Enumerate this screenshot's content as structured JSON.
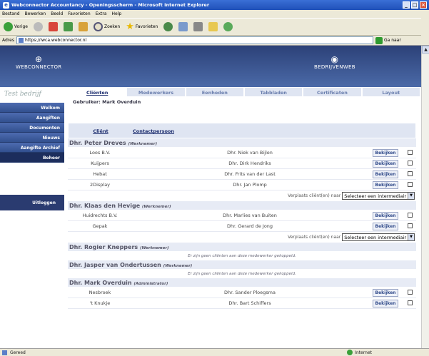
{
  "window": {
    "title": "Webconnector Accountancy - Openingsscherm - Microsoft Internet Explorer"
  },
  "menu": [
    "Bestand",
    "Bewerken",
    "Beeld",
    "Favorieten",
    "Extra",
    "Help"
  ],
  "toolbar": {
    "back": "Vorige",
    "search": "Zoeken",
    "favorites": "Favorieten"
  },
  "address": {
    "label": "Adres",
    "url": "https://iwca.webconnector.nl",
    "go": "Ga naar"
  },
  "header": {
    "left_logo": "WEBCONNECTOR",
    "right_logo": "BEDRIJVENWEB"
  },
  "company": "Test bedrijf",
  "sidebar": {
    "items": [
      {
        "label": "Welkom"
      },
      {
        "label": "Aangiften"
      },
      {
        "label": "Documenten"
      },
      {
        "label": "Nieuws"
      },
      {
        "label": "Aangifte Archief"
      },
      {
        "label": "Beheer"
      }
    ],
    "logout": "Uitloggen"
  },
  "tabs": [
    "Cliënten",
    "Medewerkers",
    "Eenheden",
    "Tabbladen",
    "Certificaten",
    "Layout"
  ],
  "user_line": "Gebruiker: Mark Overduin",
  "table": {
    "col_client": "Cliënt",
    "col_contact": "Contactpersoon",
    "view_label": "Bekijken",
    "move_label": "Verplaats cliënt(en) naar",
    "select_placeholder": "Selecteer een intermediair",
    "empty_note": "Er zijn geen cliënten aan deze medewerker gekoppeld."
  },
  "groups": [
    {
      "name": "Dhr. Peter Dreves",
      "role": "(Werknemer)",
      "rows": [
        {
          "client": "Loos B.V.",
          "contact": "Dhr. Niek van Bijlen"
        },
        {
          "client": "Kuijpers",
          "contact": "Dhr. Dirk Hendriks"
        },
        {
          "client": "Hebat",
          "contact": "Dhr. Frits van der Last"
        },
        {
          "client": "2Display",
          "contact": "Dhr. Jan Plomp"
        }
      ]
    },
    {
      "name": "Dhr. Klaas den Hevige",
      "role": "(Werknemer)",
      "rows": [
        {
          "client": "Huidrechts B.V.",
          "contact": "Dhr. Marlies van Buiten"
        },
        {
          "client": "Gepak",
          "contact": "Dhr. Gerard de Jong"
        }
      ]
    },
    {
      "name": "Dhr. Rogier Kneppers",
      "role": "(Werknemer)",
      "rows": []
    },
    {
      "name": "Dhr. Jasper van Ondertussen",
      "role": "(Werknemer)",
      "rows": []
    },
    {
      "name": "Dhr. Mark Overduin",
      "role": "(Administrator)",
      "rows": [
        {
          "client": "Nesbroek",
          "contact": "Dhr. Sander Ploegsma"
        },
        {
          "client": "'t Knukje",
          "contact": "Dhr. Bart Schiffers"
        }
      ]
    }
  ],
  "status": {
    "left": "Gereed",
    "zone": "Internet"
  }
}
